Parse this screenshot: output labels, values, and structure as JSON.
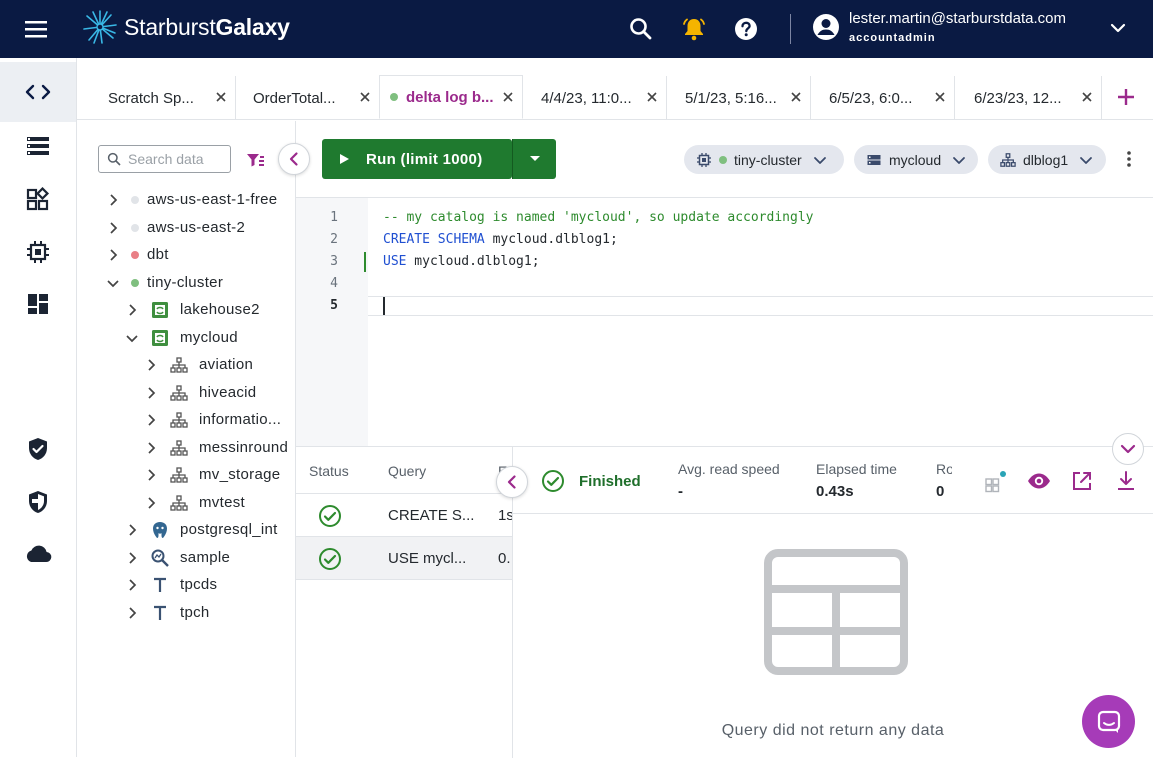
{
  "app": {
    "logo_prefix": "Starburst",
    "logo_suffix": "Galaxy",
    "user_email": "lester.martin@starburstdata.com",
    "user_role": "accountadmin"
  },
  "tabs": [
    {
      "label": "Scratch Sp..."
    },
    {
      "label": "OrderTotal..."
    },
    {
      "label": "delta log b..."
    },
    {
      "label": "4/4/23, 11:0..."
    },
    {
      "label": "5/1/23, 5:16..."
    },
    {
      "label": "6/5/23, 6:0..."
    },
    {
      "label": "6/23/23, 12..."
    }
  ],
  "catalog": {
    "search_placeholder": "Search data",
    "items": [
      {
        "label": "aws-us-east-1-free"
      },
      {
        "label": "aws-us-east-2"
      },
      {
        "label": "dbt"
      },
      {
        "label": "tiny-cluster"
      },
      {
        "label": "lakehouse2"
      },
      {
        "label": "mycloud"
      },
      {
        "label": "aviation"
      },
      {
        "label": "hiveacid"
      },
      {
        "label": "informatio..."
      },
      {
        "label": "messinround"
      },
      {
        "label": "mv_storage"
      },
      {
        "label": "mvtest"
      },
      {
        "label": "postgresql_int"
      },
      {
        "label": "sample"
      },
      {
        "label": "tpcds"
      },
      {
        "label": "tpch"
      }
    ]
  },
  "toolbar": {
    "run_label": "Run (limit 1000)",
    "cluster": "tiny-cluster",
    "catalog": "mycloud",
    "schema": "dlblog1"
  },
  "editor": {
    "line_numbers": [
      "1",
      "2",
      "3",
      "4",
      "5"
    ],
    "line1": "-- my catalog is named 'mycloud', so update accordingly",
    "line2_kw": "CREATE SCHEMA",
    "line2_rest": " mycloud.dlblog1;",
    "line3_kw": "USE",
    "line3_rest": " mycloud.dlblog1;"
  },
  "queries": {
    "col_status": "Status",
    "col_query": "Query",
    "col_e": "E",
    "rows": [
      {
        "query": "CREATE S...",
        "elapsed": "1s"
      },
      {
        "query": "USE mycl...",
        "elapsed": "0."
      }
    ]
  },
  "result": {
    "status": "Finished",
    "avg_read_label": "Avg. read speed",
    "avg_read_value": "-",
    "elapsed_label": "Elapsed time",
    "elapsed_value": "0.43s",
    "rows_label": "Ro",
    "rows_value": "0",
    "empty_message": "Query did not return any data"
  },
  "colors": {
    "topbar": "#0a1a43",
    "accent": "#9b2a8c",
    "run": "#1f7a2f",
    "success": "#2e8b2e"
  }
}
